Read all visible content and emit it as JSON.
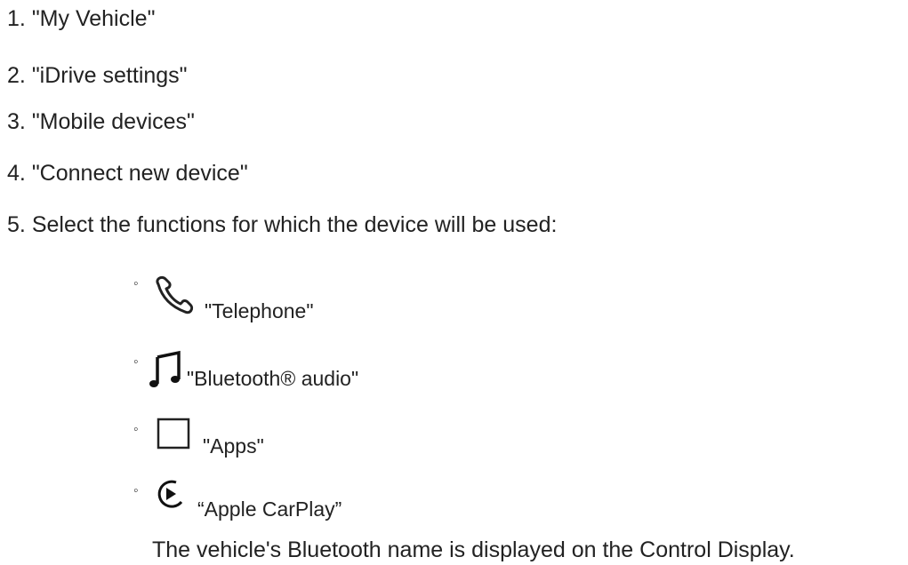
{
  "steps": [
    {
      "number": "1.",
      "text": "\"My Vehicle\""
    },
    {
      "number": "2.",
      "text": "\"iDrive settings\""
    },
    {
      "number": "3.",
      "text": "\"Mobile devices\""
    },
    {
      "number": "4.",
      "text": "\"Connect new device\""
    },
    {
      "number": "5.",
      "text": "Select the functions for which the device will be used:"
    }
  ],
  "functions": [
    {
      "bullet": "◦",
      "icon": "telephone-icon",
      "label": "\"Telephone\""
    },
    {
      "bullet": "◦",
      "icon": "music-note-icon",
      "label": "\"Bluetooth® audio\""
    },
    {
      "bullet": "◦",
      "icon": "apps-square-icon",
      "label": "\"Apps\""
    },
    {
      "bullet": "◦",
      "icon": "play-circle-icon",
      "label": "“Apple CarPlay”"
    }
  ],
  "note": "The vehicle's Bluetooth name is displayed on the Control Display."
}
